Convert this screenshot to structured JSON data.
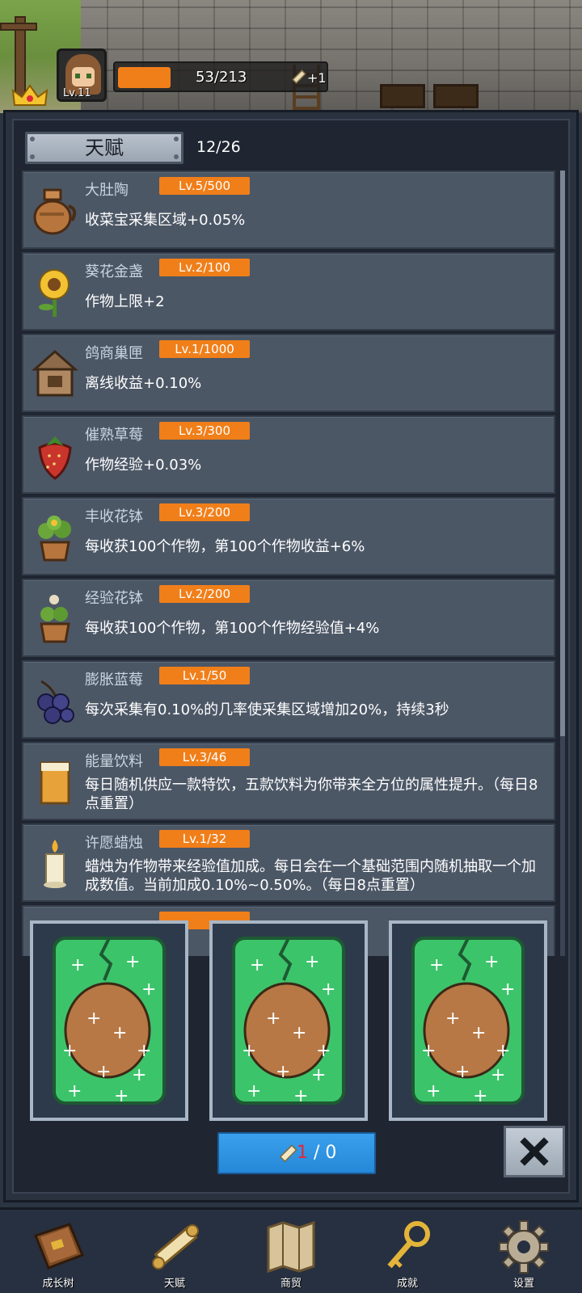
{
  "hud": {
    "level": "Lv.11",
    "exp_text": "53/213",
    "exp_fill_fraction": 0.25,
    "scroll_bonus": "+1"
  },
  "panel": {
    "tab_title": "天赋",
    "count": "12/26"
  },
  "talents": [
    {
      "name": "大肚陶",
      "level": "Lv.5/500",
      "desc": "收菜宝采集区域+0.05%",
      "icon": "pot-icon"
    },
    {
      "name": "葵花金盏",
      "level": "Lv.2/100",
      "desc": "作物上限+2",
      "icon": "sunflower-icon"
    },
    {
      "name": "鸽商巢匣",
      "level": "Lv.1/1000",
      "desc": "离线收益+0.10%",
      "icon": "birdhouse-icon"
    },
    {
      "name": "催熟草莓",
      "level": "Lv.3/300",
      "desc": "作物经验+0.03%",
      "icon": "strawberry-icon"
    },
    {
      "name": "丰收花钵",
      "level": "Lv.3/200",
      "desc": "每收获100个作物，第100个作物收益+6%",
      "icon": "flowerpot-icon"
    },
    {
      "name": "经验花钵",
      "level": "Lv.2/200",
      "desc": "每收获100个作物，第100个作物经验值+4%",
      "icon": "exp-flowerpot-icon"
    },
    {
      "name": "膨胀蓝莓",
      "level": "Lv.1/50",
      "desc": "每次采集有0.10%的几率使采集区域增加20%，持续3秒",
      "icon": "blueberry-icon"
    },
    {
      "name": "能量饮料",
      "level": "Lv.3/46",
      "desc": "每日随机供应一款特饮，五款饮料为你带来全方位的属性提升。（每日8点重置）",
      "icon": "drink-icon"
    },
    {
      "name": "许愿蜡烛",
      "level": "Lv.1/32",
      "desc": "蜡烛为作物带来经验值加成。每日会在一个基础范围内随机抽取一个加成数值。当前加成0.10%~0.50%。（每日8点重置）",
      "icon": "candle-icon"
    }
  ],
  "draw": {
    "current": "1",
    "separator": " / ",
    "total": "0"
  },
  "nav": [
    {
      "label": "成长树",
      "icon": "book-icon"
    },
    {
      "label": "天赋",
      "icon": "scroll-icon"
    },
    {
      "label": "商贸",
      "icon": "map-icon"
    },
    {
      "label": "成就",
      "icon": "key-icon"
    },
    {
      "label": "设置",
      "icon": "gear-icon"
    }
  ],
  "colors": {
    "accent_orange": "#f07f1a",
    "button_blue": "#2f94e2",
    "card_green": "#3cc46a",
    "card_brown": "#b77845"
  }
}
